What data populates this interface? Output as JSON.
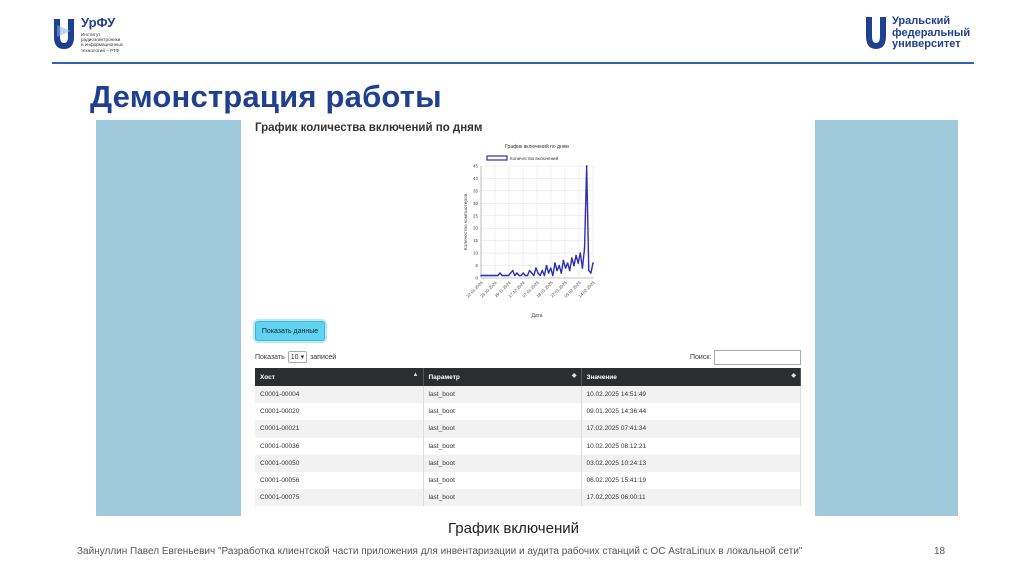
{
  "header": {
    "left_logo": {
      "brand": "УрФУ",
      "institute_lines": [
        "Институт",
        "радиоэлектроники",
        "и информационных",
        "технологий – РТФ"
      ]
    },
    "right_logo": {
      "name_lines": [
        "Уральский",
        "федеральный",
        "университет"
      ]
    },
    "accent_color": "#1f3f8f",
    "line_color": "#2a66b8"
  },
  "page_title": "Демонстрация работы",
  "app": {
    "chart_heading": "График количества включений по дням",
    "show_button": "Показать данные",
    "length": {
      "prefix": "Показать",
      "value": "10",
      "suffix": "записей"
    },
    "search": {
      "label": "Поиск:",
      "value": ""
    },
    "table": {
      "columns": [
        "Хост",
        "Параметр",
        "Значение"
      ],
      "rows": [
        [
          "C0001-00004",
          "last_boot",
          "10.02.2025 14:51:49"
        ],
        [
          "C0001-00020",
          "last_boot",
          "09.01.2025 14:36:44"
        ],
        [
          "C0001-00021",
          "last_boot",
          "17.02.2025 07:41:34"
        ],
        [
          "C0001-00036",
          "last_boot",
          "10.02.2025 08:12:21"
        ],
        [
          "C0001-00050",
          "last_boot",
          "03.02.2025 10:24:13"
        ],
        [
          "C0001-00056",
          "last_boot",
          "06.02.2025 15:41:19"
        ],
        [
          "C0001-00075",
          "last_boot",
          "17.02.2025 06:00:11"
        ]
      ]
    }
  },
  "chart_data": {
    "type": "line",
    "title": "График включений по дням",
    "xlabel": "Дата",
    "ylabel": "Количество компьютеров",
    "legend": "Количество включений",
    "legend_position": "top",
    "grid": true,
    "ylim": [
      0,
      45
    ],
    "yticks": [
      0,
      5,
      10,
      15,
      20,
      25,
      30,
      35,
      40,
      45
    ],
    "xtick_labels": [
      "22.01.2024",
      "26.10.2024",
      "29.11.2024",
      "17.12.2024",
      "07.01.2025",
      "18.01.2025",
      "27.01.2025",
      "05.02.2025",
      "14.02.2025"
    ],
    "series_color": "#2a2fb8",
    "series": [
      {
        "name": "Количество включений",
        "values": [
          1,
          1,
          1,
          1,
          1,
          1,
          1,
          1,
          1,
          2,
          1,
          1,
          1,
          1,
          2,
          3,
          1,
          2,
          1,
          1,
          2,
          1,
          1,
          3,
          2,
          1,
          4,
          2,
          1,
          3,
          1,
          5,
          2,
          4,
          1,
          6,
          3,
          5,
          2,
          7,
          4,
          6,
          3,
          8,
          5,
          9,
          6,
          10,
          4,
          12,
          45,
          3,
          2,
          6
        ]
      }
    ]
  },
  "caption": "График включений",
  "footer": "Зайнуллин Павел Евгеньевич \"Разработка клиентской части приложения для инвентаризации и аудита рабочих станций с ОС AstraLinux в локальной сети\"",
  "page_number": "18"
}
